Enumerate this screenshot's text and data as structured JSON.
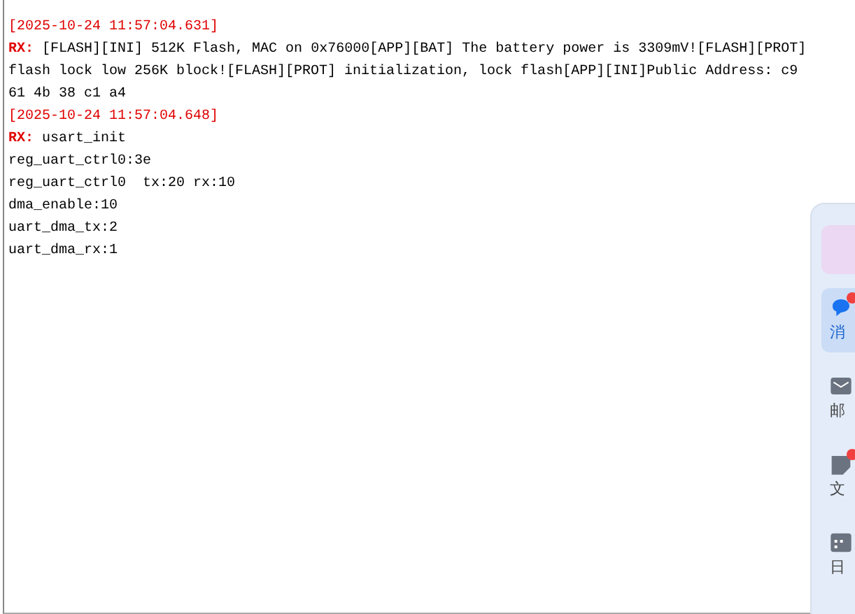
{
  "log": [
    {
      "kind": "timestamp",
      "text": "[2025-10-24 11:57:04.631]"
    },
    {
      "kind": "rx",
      "prefix": "RX:",
      "text": "[FLASH][INI] 512K Flash, MAC on 0x76000[APP][BAT] The battery power is 3309mV![FLASH][PROT]"
    },
    {
      "kind": "plain",
      "text": "flash lock low 256K block![FLASH][PROT] initialization, lock flash[APP][INI]Public Address: c9"
    },
    {
      "kind": "plain",
      "text": "61 4b 38 c1 a4"
    },
    {
      "kind": "timestamp",
      "text": "[2025-10-24 11:57:04.648]"
    },
    {
      "kind": "rx",
      "prefix": "RX:",
      "text": "usart_init"
    },
    {
      "kind": "plain",
      "text": "reg_uart_ctrl0:3e"
    },
    {
      "kind": "plain",
      "text": "reg_uart_ctrl0  tx:20 rx:10"
    },
    {
      "kind": "plain",
      "text": "dma_enable:10"
    },
    {
      "kind": "plain",
      "text": "uart_dma_tx:2"
    },
    {
      "kind": "plain",
      "text": "uart_dma_rx:1"
    }
  ],
  "side_panel": {
    "items": [
      {
        "kind": "avatar"
      },
      {
        "kind": "chat",
        "label": "消",
        "selected": true,
        "badge": true
      },
      {
        "kind": "mail",
        "label": "邮",
        "selected": false,
        "badge": false
      },
      {
        "kind": "doc",
        "label": "文",
        "selected": false,
        "badge": true
      },
      {
        "kind": "calendar",
        "label": "日",
        "selected": false,
        "badge": false
      }
    ]
  }
}
